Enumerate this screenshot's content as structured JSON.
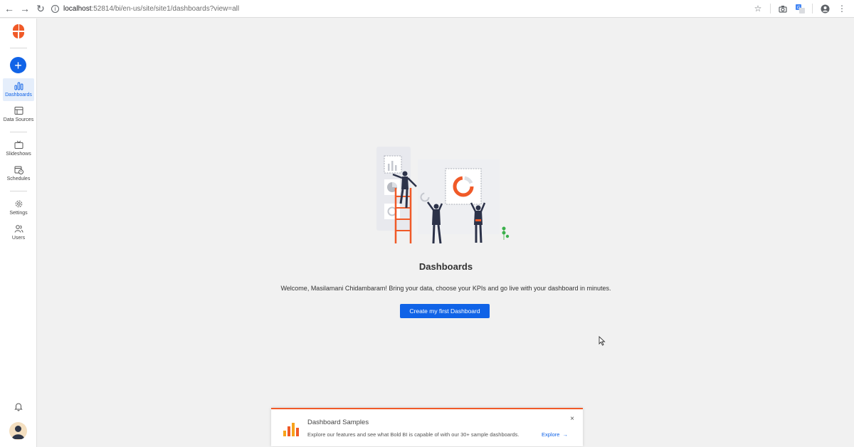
{
  "browser": {
    "url_host": "localhost",
    "url_path": ":52814/bi/en-us/site/site1/dashboards?view=all"
  },
  "sidebar": {
    "items": [
      {
        "label": "Dashboards",
        "icon": "bar-chart-icon",
        "active": true
      },
      {
        "label": "Data Sources",
        "icon": "data-source-icon",
        "active": false
      },
      {
        "label": "Slideshows",
        "icon": "tv-icon",
        "active": false
      },
      {
        "label": "Schedules",
        "icon": "calendar-clock-icon",
        "active": false
      },
      {
        "label": "Settings",
        "icon": "gear-icon",
        "active": false
      },
      {
        "label": "Users",
        "icon": "users-icon",
        "active": false
      }
    ]
  },
  "main": {
    "title": "Dashboards",
    "welcome": "Welcome, Masilamani Chidambaram! Bring your data, choose your KPIs and go live with your dashboard in minutes.",
    "create_button": "Create my first Dashboard"
  },
  "banner": {
    "title": "Dashboard Samples",
    "description": "Explore our features and see what Bold BI is capable of with our 30+ sample dashboards.",
    "explore_label": "Explore",
    "close_label": "×"
  },
  "colors": {
    "accent": "#1063e7",
    "brand": "#f05a28"
  }
}
